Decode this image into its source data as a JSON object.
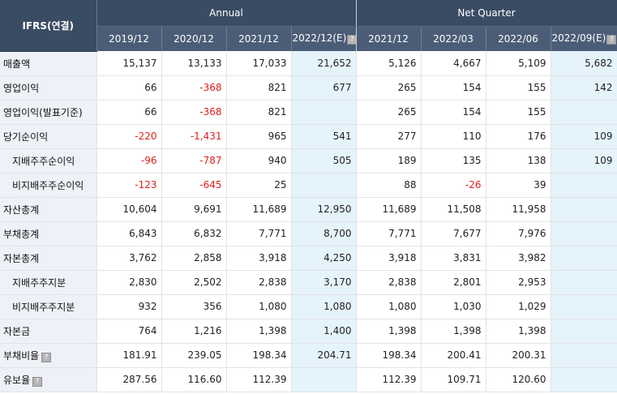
{
  "header": {
    "corner": "IFRS(연결)",
    "groups": [
      "Annual",
      "Net Quarter"
    ],
    "periods": [
      "2019/12",
      "2020/12",
      "2021/12",
      "2022/12(E)",
      "2021/12",
      "2022/03",
      "2022/06",
      "2022/09(E)"
    ]
  },
  "colors": {
    "header_bg": "#3a4c64",
    "estimate_bg": "#e5f3fb",
    "label_bg": "#eef1f7",
    "negative": "#e02020"
  },
  "rows": [
    {
      "label": "매출액",
      "sub": false,
      "help": false,
      "values": [
        "15,137",
        "13,133",
        "17,033",
        "21,652",
        "5,126",
        "4,667",
        "5,109",
        "5,682"
      ]
    },
    {
      "label": "영업이익",
      "sub": false,
      "help": false,
      "values": [
        "66",
        "-368",
        "821",
        "677",
        "265",
        "154",
        "155",
        "142"
      ]
    },
    {
      "label": "영업이익(발표기준)",
      "sub": false,
      "help": false,
      "values": [
        "66",
        "-368",
        "821",
        "",
        "265",
        "154",
        "155",
        ""
      ]
    },
    {
      "label": "당기순이익",
      "sub": false,
      "help": false,
      "values": [
        "-220",
        "-1,431",
        "965",
        "541",
        "277",
        "110",
        "176",
        "109"
      ]
    },
    {
      "label": "지배주주순이익",
      "sub": true,
      "help": false,
      "values": [
        "-96",
        "-787",
        "940",
        "505",
        "189",
        "135",
        "138",
        "109"
      ]
    },
    {
      "label": "비지배주주순이익",
      "sub": true,
      "help": false,
      "values": [
        "-123",
        "-645",
        "25",
        "",
        "88",
        "-26",
        "39",
        ""
      ]
    },
    {
      "label": "자산총계",
      "sub": false,
      "help": false,
      "values": [
        "10,604",
        "9,691",
        "11,689",
        "12,950",
        "11,689",
        "11,508",
        "11,958",
        ""
      ]
    },
    {
      "label": "부채총계",
      "sub": false,
      "help": false,
      "values": [
        "6,843",
        "6,832",
        "7,771",
        "8,700",
        "7,771",
        "7,677",
        "7,976",
        ""
      ]
    },
    {
      "label": "자본총계",
      "sub": false,
      "help": false,
      "values": [
        "3,762",
        "2,858",
        "3,918",
        "4,250",
        "3,918",
        "3,831",
        "3,982",
        ""
      ]
    },
    {
      "label": "지배주주지분",
      "sub": true,
      "help": false,
      "values": [
        "2,830",
        "2,502",
        "2,838",
        "3,170",
        "2,838",
        "2,801",
        "2,953",
        ""
      ]
    },
    {
      "label": "비지배주주지분",
      "sub": true,
      "help": false,
      "values": [
        "932",
        "356",
        "1,080",
        "1,080",
        "1,080",
        "1,030",
        "1,029",
        ""
      ]
    },
    {
      "label": "자본금",
      "sub": false,
      "help": false,
      "values": [
        "764",
        "1,216",
        "1,398",
        "1,400",
        "1,398",
        "1,398",
        "1,398",
        ""
      ]
    },
    {
      "label": "부채비율",
      "sub": false,
      "help": true,
      "values": [
        "181.91",
        "239.05",
        "198.34",
        "204.71",
        "198.34",
        "200.41",
        "200.31",
        ""
      ]
    },
    {
      "label": "유보율",
      "sub": false,
      "help": true,
      "values": [
        "287.56",
        "116.60",
        "112.39",
        "",
        "112.39",
        "109.71",
        "120.60",
        ""
      ]
    }
  ]
}
